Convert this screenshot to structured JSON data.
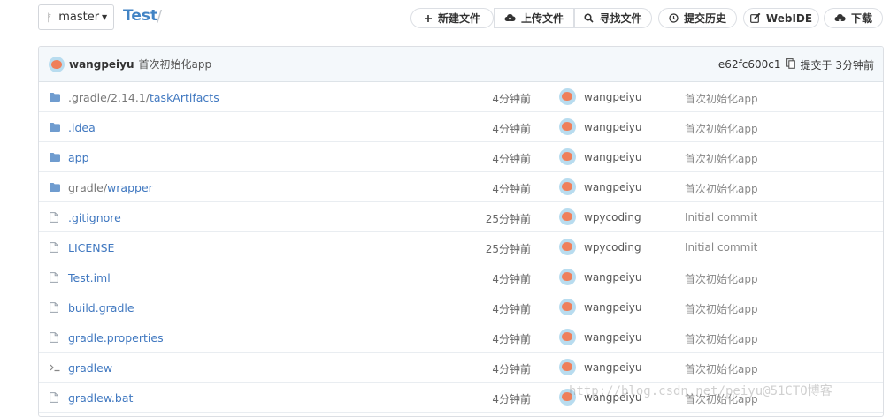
{
  "toolbar": {
    "branch": "master",
    "repo_name": "Test",
    "separator": "/",
    "buttons": [
      {
        "label": "新建文件",
        "icon": "plus-icon"
      },
      {
        "label": "上传文件",
        "icon": "cloud-upload-icon"
      },
      {
        "label": "寻找文件",
        "icon": "search-icon"
      },
      {
        "label": "提交历史",
        "icon": "clock-icon"
      },
      {
        "label": "WebIDE",
        "icon": "edit-icon"
      },
      {
        "label": "下载",
        "icon": "cloud-download-icon"
      }
    ]
  },
  "last_commit": {
    "author": "wangpeiyu",
    "message": "首次初始化app",
    "sha": "e62fc600c1",
    "time": "提交于 3分钟前"
  },
  "files": [
    {
      "type": "folder",
      "prefix": ".gradle/2.14.1/",
      "name": "taskArtifacts",
      "time": "4分钟前",
      "author": "wangpeiyu",
      "message": "首次初始化app"
    },
    {
      "type": "folder",
      "prefix": "",
      "name": ".idea",
      "time": "4分钟前",
      "author": "wangpeiyu",
      "message": "首次初始化app"
    },
    {
      "type": "folder",
      "prefix": "",
      "name": "app",
      "time": "4分钟前",
      "author": "wangpeiyu",
      "message": "首次初始化app"
    },
    {
      "type": "folder",
      "prefix": "gradle/",
      "name": "wrapper",
      "time": "4分钟前",
      "author": "wangpeiyu",
      "message": "首次初始化app"
    },
    {
      "type": "file",
      "prefix": "",
      "name": ".gitignore",
      "time": "25分钟前",
      "author": "wpycoding",
      "message": "Initial commit"
    },
    {
      "type": "file",
      "prefix": "",
      "name": "LICENSE",
      "time": "25分钟前",
      "author": "wpycoding",
      "message": "Initial commit"
    },
    {
      "type": "file",
      "prefix": "",
      "name": "Test.iml",
      "time": "4分钟前",
      "author": "wangpeiyu",
      "message": "首次初始化app"
    },
    {
      "type": "file",
      "prefix": "",
      "name": "build.gradle",
      "time": "4分钟前",
      "author": "wangpeiyu",
      "message": "首次初始化app"
    },
    {
      "type": "file",
      "prefix": "",
      "name": "gradle.properties",
      "time": "4分钟前",
      "author": "wangpeiyu",
      "message": "首次初始化app"
    },
    {
      "type": "terminal",
      "prefix": "",
      "name": "gradlew",
      "time": "4分钟前",
      "author": "wangpeiyu",
      "message": "首次初始化app"
    },
    {
      "type": "file",
      "prefix": "",
      "name": "gradlew.bat",
      "time": "4分钟前",
      "author": "wangpeiyu",
      "message": "首次初始化app"
    }
  ],
  "watermark": "http://blog.csdn.net/peiyu@51CTO博客",
  "colors": {
    "link": "#4078c0",
    "folder": "#6f9ccf",
    "commit_bar": "#f4f8fb"
  }
}
